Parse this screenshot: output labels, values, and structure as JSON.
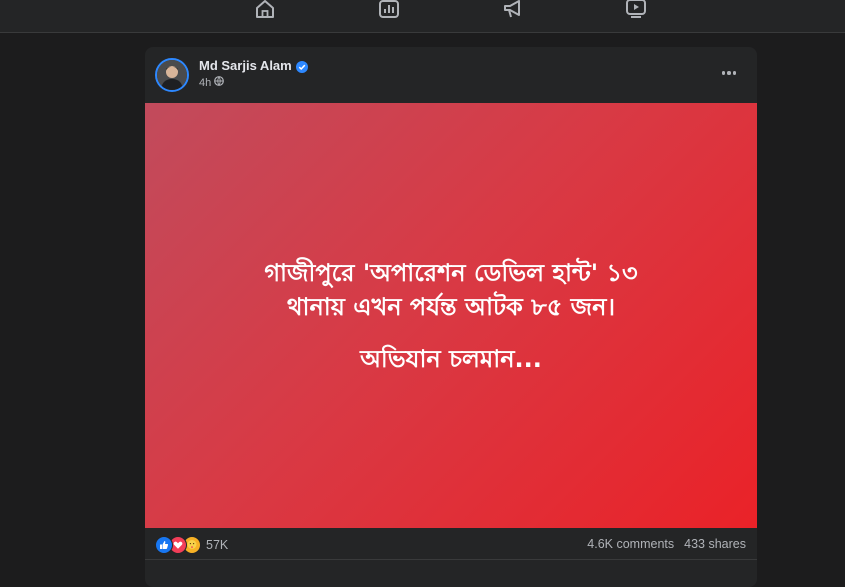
{
  "nav": {
    "icons": [
      "home-icon",
      "chart-icon",
      "megaphone-icon",
      "video-icon"
    ]
  },
  "post": {
    "author": "Md Sarjis Alam",
    "verified": true,
    "time": "4h",
    "privacy_icon": "globe-icon",
    "background_colors": [
      "#c14b5c",
      "#ea2228"
    ],
    "text_line1": "গাজীপুরে 'অপারেশন ডেভিল হান্ট' ১৩",
    "text_line2": "থানায় এখন পর্যন্ত আটক ৮৫ জন।",
    "text_line3": "অভিযান চলমান...",
    "reaction_icons": [
      "like-icon",
      "love-icon",
      "care-icon"
    ],
    "reaction_count": "57K",
    "comments": "4.6K comments",
    "shares": "433 shares"
  },
  "colors": {
    "verified_badge": "#2d88ff",
    "background": "#1c1c1d",
    "card": "#242526"
  }
}
